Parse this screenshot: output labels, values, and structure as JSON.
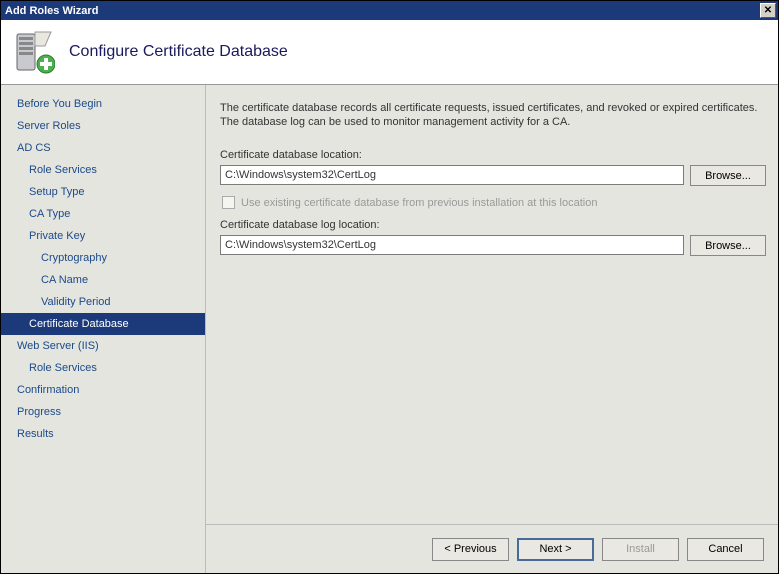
{
  "window": {
    "title": "Add Roles Wizard"
  },
  "header": {
    "title": "Configure Certificate Database"
  },
  "sidebar": {
    "items": [
      {
        "label": "Before You Begin",
        "level": 0
      },
      {
        "label": "Server Roles",
        "level": 0
      },
      {
        "label": "AD CS",
        "level": 0
      },
      {
        "label": "Role Services",
        "level": 1
      },
      {
        "label": "Setup Type",
        "level": 1
      },
      {
        "label": "CA Type",
        "level": 1
      },
      {
        "label": "Private Key",
        "level": 1
      },
      {
        "label": "Cryptography",
        "level": 2
      },
      {
        "label": "CA Name",
        "level": 2
      },
      {
        "label": "Validity Period",
        "level": 2
      },
      {
        "label": "Certificate Database",
        "level": 1,
        "selected": true
      },
      {
        "label": "Web Server (IIS)",
        "level": 0
      },
      {
        "label": "Role Services",
        "level": 1
      },
      {
        "label": "Confirmation",
        "level": 0
      },
      {
        "label": "Progress",
        "level": 0
      },
      {
        "label": "Results",
        "level": 0
      }
    ]
  },
  "content": {
    "description": "The certificate database records all certificate requests, issued certificates, and revoked or expired certificates. The database log can be used to monitor management activity for a CA.",
    "db_location_label": "Certificate database location:",
    "db_location_value": "C:\\Windows\\system32\\CertLog",
    "checkbox_label": "Use existing certificate database from previous installation at this location",
    "log_location_label": "Certificate database log location:",
    "log_location_value": "C:\\Windows\\system32\\CertLog",
    "browse_label": "Browse..."
  },
  "footer": {
    "previous": "< Previous",
    "next": "Next >",
    "install": "Install",
    "cancel": "Cancel"
  }
}
